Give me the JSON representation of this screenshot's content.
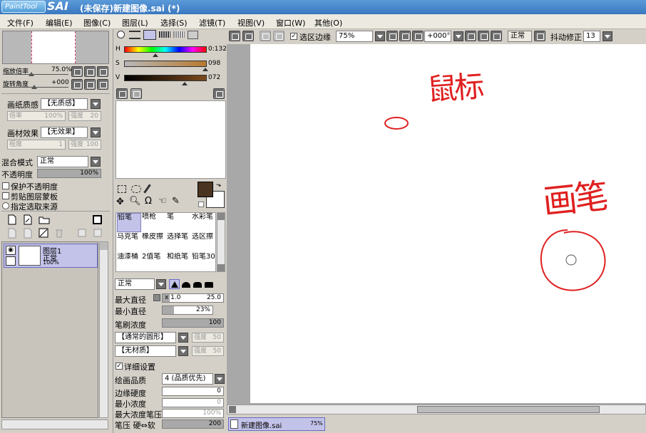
{
  "window": {
    "logo_text": "PaintTool",
    "app_name": "SAI",
    "title": "(未保存)新建图像.sai (*)"
  },
  "menu": [
    "文件(F)",
    "编辑(E)",
    "图像(C)",
    "图层(L)",
    "选择(S)",
    "滤镜(T)",
    "视图(V)",
    "窗口(W)",
    "其他(O)"
  ],
  "navigator": {
    "zoom_label": "缩放倍率",
    "zoom_value": "75.0%",
    "rotate_label": "旋转角度",
    "rotate_value": "+000"
  },
  "layer_props": {
    "paper_texture_label": "画纸质感",
    "paper_texture_value": "【无质感】",
    "scale_label": "倍率",
    "scale_value": "100%",
    "intensity_label": "强度",
    "intensity_value": "20",
    "paper_effect_label": "画材效果",
    "paper_effect_value": "【无效果】",
    "degree_label": "程度",
    "degree_value": "1",
    "intensity2_label": "强度",
    "intensity2_value": "100",
    "blend_label": "混合模式",
    "blend_value": "正常",
    "opacity_label": "不透明度",
    "opacity_value": "100%",
    "opacity_fraction": 1.0,
    "protect_alpha": "保护不透明度",
    "clip_mask": "剪贴图层蒙板",
    "select_source": "指定选取来源"
  },
  "layers": [
    {
      "name": "图层1",
      "mode": "正常",
      "opacity": "100%"
    }
  ],
  "color": {
    "h_label": "H",
    "h_value": "0:132",
    "s_label": "S",
    "s_value": "098",
    "v_label": "V",
    "v_value": "072",
    "fg_color": "#4a3320",
    "bg_color": "#ffffff"
  },
  "tools": [
    {
      "label": "铅笔",
      "selected": true
    },
    {
      "label": "喷枪",
      "selected": false
    },
    {
      "label": "笔",
      "selected": false
    },
    {
      "label": "水彩笔",
      "selected": false
    },
    {
      "label": "马克笔",
      "selected": false
    },
    {
      "label": "橡皮擦",
      "selected": false
    },
    {
      "label": "选择笔",
      "selected": false
    },
    {
      "label": "选区擦",
      "selected": false
    },
    {
      "label": "油漆桶",
      "selected": false
    },
    {
      "label": "2值笔",
      "selected": false
    },
    {
      "label": "和纸笔",
      "selected": false
    },
    {
      "label": "铅笔30",
      "selected": false
    }
  ],
  "brush": {
    "mode_value": "正常",
    "max_size_label": "最大直径",
    "max_size_mult": "x 1.0",
    "max_size_value": "25.0",
    "min_size_label": "最小直径",
    "min_size_value": "23%",
    "min_size_fraction": 0.23,
    "density_label": "笔刷浓度",
    "density_value": "100",
    "density_fraction": 1.0,
    "shape_value": "【通常的圆形】",
    "shape_intensity_label": "强度",
    "shape_intensity_value": "50",
    "texture_value": "【无材质】",
    "texture_intensity_label": "强度",
    "texture_intensity_value": "50",
    "detail_label": "详细设置",
    "quality_label": "绘画品质",
    "quality_value": "4 (品质优先)",
    "edge_label": "边缘硬度",
    "edge_value": "0",
    "min_density_label": "最小浓度",
    "min_density_value": "0",
    "max_pressure_label": "最大浓度笔压",
    "max_pressure_value": "100%",
    "pressure_label": "笔压 硬⇔软",
    "pressure_value": "200",
    "pressure_fraction": 1.0
  },
  "canvas_toolbar": {
    "selection_edge_label": "选区边缘",
    "zoom_value": "75%",
    "angle_value": "+000°",
    "mode_value": "正常",
    "stabilizer_label": "抖动修正",
    "stabilizer_value": "13"
  },
  "canvas": {
    "annotation_mouse": "鼠标",
    "annotation_pen": "画笔"
  },
  "document_tab": {
    "name": "新建图像.sai",
    "zoom": "75%"
  }
}
